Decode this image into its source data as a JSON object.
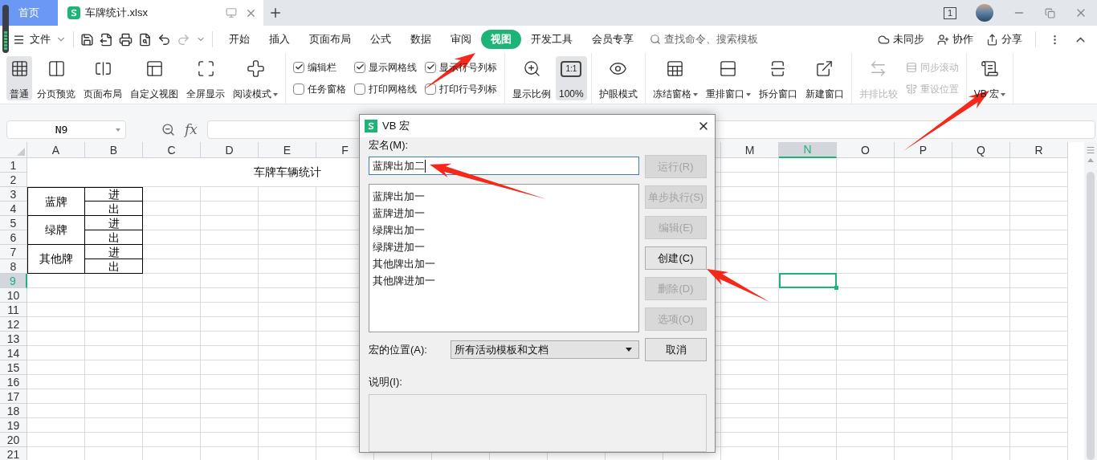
{
  "tabs": [
    {
      "label": "首页",
      "kind": "home",
      "selected": false
    },
    {
      "label": "车牌统计.xlsx",
      "kind": "doc",
      "selected": true
    }
  ],
  "window_badge": "1",
  "menu": {
    "file": "文件",
    "tabs": [
      {
        "label": "开始",
        "selected": false
      },
      {
        "label": "插入",
        "selected": false
      },
      {
        "label": "页面布局",
        "selected": false
      },
      {
        "label": "公式",
        "selected": false
      },
      {
        "label": "数据",
        "selected": false
      },
      {
        "label": "审阅",
        "selected": false
      },
      {
        "label": "视图",
        "selected": true
      },
      {
        "label": "开发工具",
        "selected": false
      },
      {
        "label": "会员专享",
        "selected": false
      }
    ],
    "search_placeholder": "查找命令、搜索模板",
    "actions": [
      "未同步",
      "协作",
      "分享"
    ]
  },
  "ribbon": [
    {
      "items": [
        {
          "kind": "large",
          "label": "普通",
          "selected": true,
          "disabled": false,
          "dropdown": false
        },
        {
          "kind": "large",
          "label": "分页预览",
          "selected": false,
          "disabled": false,
          "dropdown": false
        },
        {
          "kind": "large",
          "label": "页面布局",
          "selected": false,
          "disabled": false,
          "dropdown": false
        },
        {
          "kind": "large",
          "label": "自定义视图",
          "selected": false,
          "disabled": false,
          "dropdown": false
        },
        {
          "kind": "large",
          "label": "全屏显示",
          "selected": false,
          "disabled": false,
          "dropdown": false
        },
        {
          "kind": "large",
          "label": "阅读模式",
          "selected": false,
          "disabled": false,
          "dropdown": true
        }
      ]
    },
    {
      "items": [
        {
          "kind": "checks",
          "options": [
            {
              "label": "编辑栏",
              "checked": true
            },
            {
              "label": "任务窗格",
              "checked": false
            }
          ]
        },
        {
          "kind": "checks",
          "options": [
            {
              "label": "显示网格线",
              "checked": true
            },
            {
              "label": "打印网格线",
              "checked": false
            }
          ]
        },
        {
          "kind": "checks",
          "options": [
            {
              "label": "显示行号列标",
              "checked": true
            },
            {
              "label": "打印行号列标",
              "checked": false
            }
          ]
        }
      ]
    },
    {
      "items": [
        {
          "kind": "large",
          "label": "显示比例",
          "selected": false,
          "disabled": false,
          "dropdown": false
        },
        {
          "kind": "large",
          "label": "100%",
          "icon_text": "1:1",
          "selected": true,
          "disabled": false,
          "dropdown": false
        }
      ]
    },
    {
      "items": [
        {
          "kind": "large",
          "label": "护眼模式",
          "selected": false,
          "disabled": false,
          "dropdown": false
        }
      ]
    },
    {
      "items": [
        {
          "kind": "large",
          "label": "冻结窗格",
          "selected": false,
          "disabled": false,
          "dropdown": true
        },
        {
          "kind": "large",
          "label": "重排窗口",
          "selected": false,
          "disabled": false,
          "dropdown": true
        },
        {
          "kind": "large",
          "label": "拆分窗口",
          "selected": false,
          "disabled": false,
          "dropdown": false
        },
        {
          "kind": "large",
          "label": "新建窗口",
          "selected": false,
          "disabled": false,
          "dropdown": false
        }
      ]
    },
    {
      "items": [
        {
          "kind": "large",
          "label": "并排比较",
          "selected": false,
          "disabled": true,
          "dropdown": false
        },
        {
          "kind": "smalls",
          "options": [
            {
              "label": "同步滚动",
              "disabled": true
            },
            {
              "label": "重设位置",
              "disabled": true
            }
          ]
        }
      ]
    },
    {
      "items": [
        {
          "kind": "large",
          "label": "VB 宏",
          "selected": false,
          "disabled": false,
          "dropdown": true
        }
      ]
    }
  ],
  "name_box": "N9",
  "formula_label": "fx",
  "sheet": {
    "columns_left": [
      {
        "label": "A",
        "selected": false
      },
      {
        "label": "B",
        "selected": false
      },
      {
        "label": "C",
        "selected": false
      },
      {
        "label": "D",
        "selected": false
      },
      {
        "label": "E",
        "selected": false
      },
      {
        "label": "F",
        "selected": false
      }
    ],
    "columns_right": [
      {
        "label": "M",
        "selected": false
      },
      {
        "label": "N",
        "selected": true
      },
      {
        "label": "O",
        "selected": false
      },
      {
        "label": "P",
        "selected": false
      },
      {
        "label": "Q",
        "selected": false
      },
      {
        "label": "R",
        "selected": false
      }
    ],
    "rows": [
      {
        "label": "1",
        "selected": false
      },
      {
        "label": "2",
        "selected": false
      },
      {
        "label": "3",
        "selected": false
      },
      {
        "label": "4",
        "selected": false
      },
      {
        "label": "5",
        "selected": false
      },
      {
        "label": "6",
        "selected": false
      },
      {
        "label": "7",
        "selected": false
      },
      {
        "label": "8",
        "selected": false
      },
      {
        "label": "9",
        "selected": true
      },
      {
        "label": "10",
        "selected": false
      },
      {
        "label": "11",
        "selected": false
      },
      {
        "label": "12",
        "selected": false
      },
      {
        "label": "13",
        "selected": false
      },
      {
        "label": "14",
        "selected": false
      },
      {
        "label": "15",
        "selected": false
      },
      {
        "label": "16",
        "selected": false
      },
      {
        "label": "17",
        "selected": false
      },
      {
        "label": "18",
        "selected": false
      },
      {
        "label": "19",
        "selected": false
      },
      {
        "label": "20",
        "selected": false
      },
      {
        "label": "21",
        "selected": false
      }
    ],
    "title": "车牌车辆统计",
    "groups": [
      {
        "name": "蓝牌",
        "items": [
          "进",
          "出"
        ]
      },
      {
        "name": "绿牌",
        "items": [
          "进",
          "出"
        ]
      },
      {
        "name": "其他牌",
        "items": [
          "进",
          "出"
        ]
      }
    ]
  },
  "dialog": {
    "title": "VB 宏",
    "name_label": "宏名(M):",
    "name_value": "蓝牌出加二",
    "macros": [
      "蓝牌出加一",
      "蓝牌进加一",
      "绿牌出加一",
      "绿牌进加一",
      "其他牌出加一",
      "其他牌进加一"
    ],
    "buttons": [
      {
        "label": "运行(R)",
        "disabled": true
      },
      {
        "label": "单步执行(S)",
        "disabled": true
      },
      {
        "label": "编辑(E)",
        "disabled": true
      },
      {
        "label": "创建(C)",
        "disabled": false
      },
      {
        "label": "删除(D)",
        "disabled": true
      },
      {
        "label": "选项(O)",
        "disabled": true
      },
      {
        "label": "取消",
        "disabled": false
      }
    ],
    "location_label": "宏的位置(A):",
    "location_value": "所有活动模板和文档",
    "description_label": "说明(I):"
  }
}
